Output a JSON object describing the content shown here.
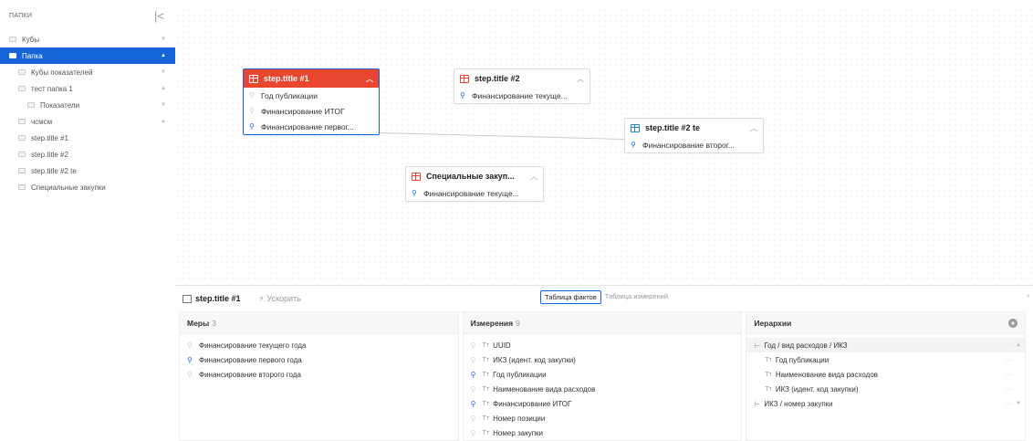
{
  "sidebar": {
    "title": "ПАПКИ",
    "items": [
      {
        "label": "Кубы",
        "indent": 0,
        "active": false
      },
      {
        "label": "Папка",
        "indent": 0,
        "active": true
      },
      {
        "label": "Кубы показателей",
        "indent": 1,
        "active": false
      },
      {
        "label": "тест папка 1",
        "indent": 1,
        "active": false
      },
      {
        "label": "Показатели",
        "indent": 2,
        "active": false
      },
      {
        "label": "чсмсм",
        "indent": 1,
        "active": false
      },
      {
        "label": "step.title #1",
        "indent": 1,
        "active": false
      },
      {
        "label": "step.title #2",
        "indent": 1,
        "active": false
      },
      {
        "label": "step.title #2 te",
        "indent": 1,
        "active": false
      },
      {
        "label": "Специальные закупки",
        "indent": 1,
        "active": false
      }
    ]
  },
  "nodes": {
    "n1": {
      "title": "step.title #1",
      "rows": [
        "Год публикации",
        "Финансирование ИТОГ",
        "Финансирование первог..."
      ]
    },
    "n2": {
      "title": "step.title #2",
      "rows": [
        "Финансирование текуще..."
      ]
    },
    "n3": {
      "title": "step.title #2 te",
      "rows": [
        "Финансирование второг..."
      ]
    },
    "n4": {
      "title": "Специальные закуп...",
      "rows": [
        "Финансирование текуще..."
      ]
    }
  },
  "bottom": {
    "title": "step.title #1",
    "boost": "Ускорить",
    "tab_facts": "Таблица фактов",
    "tab_dims": "Таблица измерений",
    "measures": {
      "title": "Меры",
      "count": "3",
      "items": [
        "Финансирование текущего года",
        "Финансирование первого года",
        "Финансирование второго года"
      ]
    },
    "dimensions": {
      "title": "Измерения",
      "count": "9",
      "items": [
        "UUID",
        "ИКЗ (идент. код закупки)",
        "Год публикации",
        "Наименование вида расходов",
        "Финансирование ИТОГ",
        "Номер позиции",
        "Номер закупки"
      ]
    },
    "hierarchies": {
      "title": "Иерархии",
      "items": [
        "Год / вид расходов / ИКЗ",
        "Год публикации",
        "Наименование вида расходов",
        "ИКЗ (идент. код закупки)",
        "ИКЗ / номер закупки"
      ]
    }
  }
}
